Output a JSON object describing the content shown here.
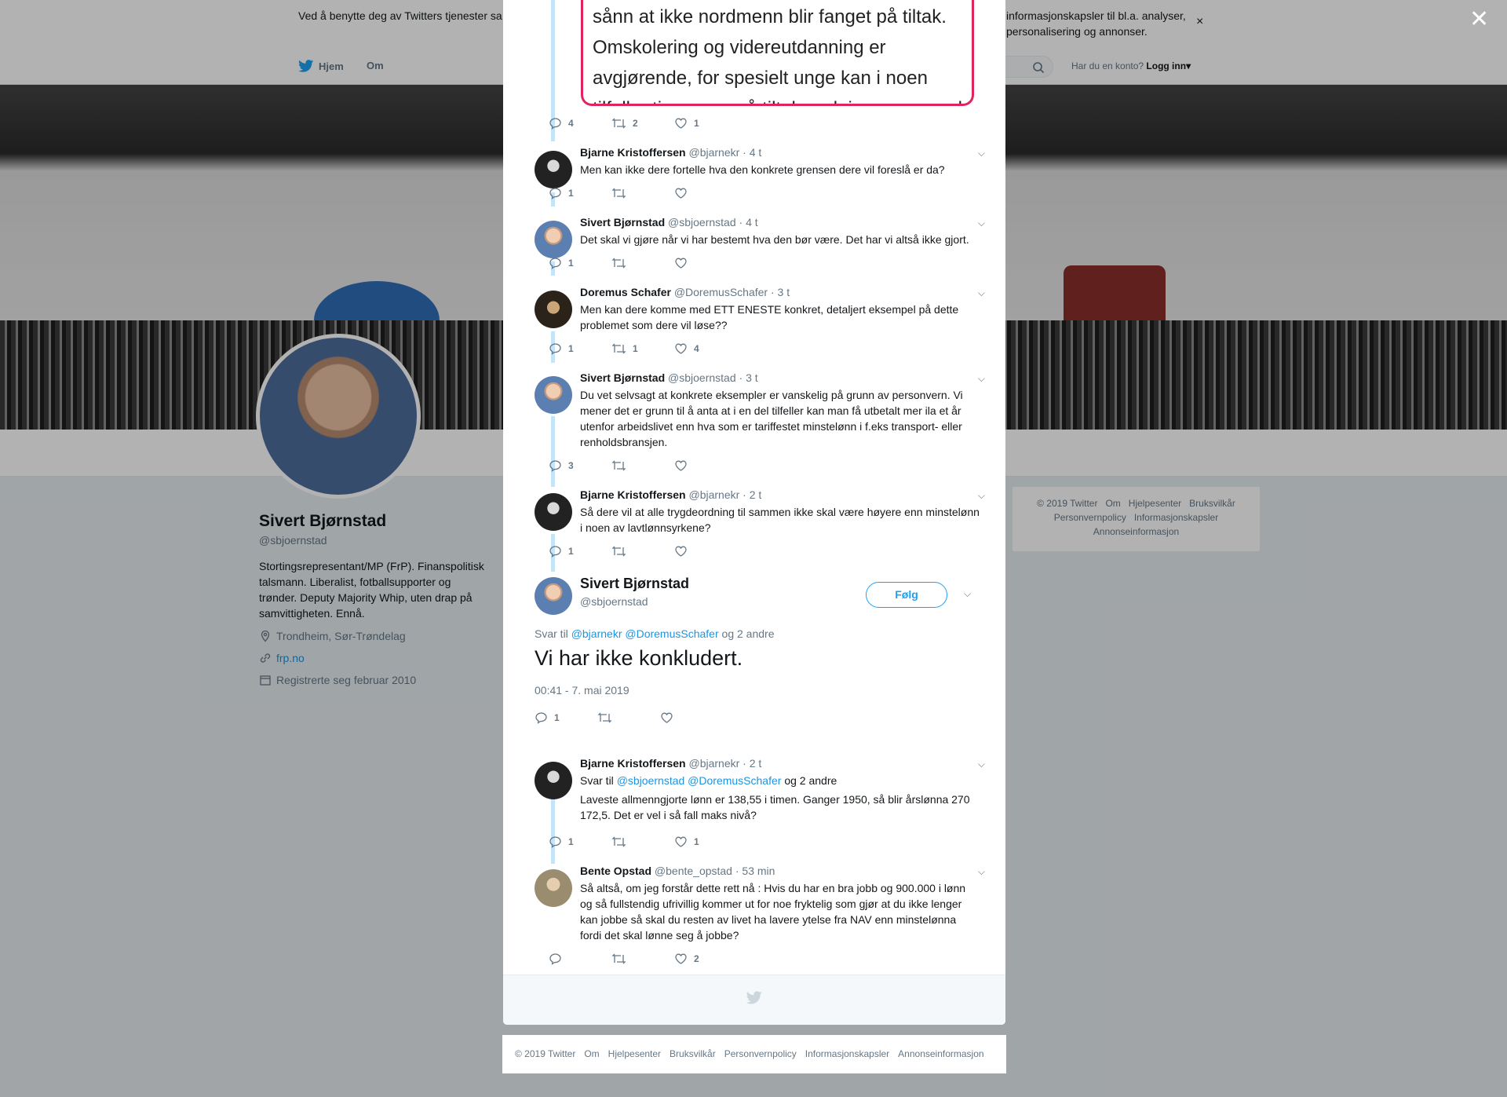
{
  "cookie": {
    "text_left": "Ved å benytte deg av Twitters tjenester sa",
    "text_right": "informasjonskapsler til bl.a. analyser, personalisering og annonser.",
    "close": "×"
  },
  "nav": {
    "home": "Hjem",
    "about": "Om",
    "login_prompt": "Har du en konto?",
    "login": "Logg inn"
  },
  "profile": {
    "name": "Sivert Bjørnstad",
    "handle": "@sbjoernstad",
    "bio": "Stortingsrepresentant/MP (FrP). Finanspolitisk talsmann. Liberalist, fotballsupporter og trønder. Deputy Majority Whip, uten drap på samvittigheten. Ennå.",
    "location": "Trondheim, Sør-Trøndelag",
    "website": "frp.no",
    "joined": "Registrerte seg februar 2010"
  },
  "side_footer": {
    "links": [
      "© 2019 Twitter",
      "Om",
      "Hjelpesenter",
      "Bruksvilkår",
      "Personvernpolicy",
      "Informasjonskapsler",
      "Annonseinformasjon"
    ]
  },
  "modal": {
    "close": "✕",
    "photo_lines": [
      "sånn at ikke nordmenn blir fanget på tiltak.",
      "Omskolering og videreutdanning er",
      "avgjørende, for spesielt unge kan i noen",
      "tilfeller tjene mer på tiltaksordninger enn ved å"
    ],
    "top_actions": {
      "replies": "4",
      "retweets": "2",
      "likes": "1"
    },
    "tweets": [
      {
        "name": "Bjarne Kristoffersen",
        "handle": "@bjarnekr",
        "time": "· 4 t",
        "text": "Men kan ikke dere fortelle hva den konkrete grensen dere vil foreslå er da?",
        "replies": "1",
        "retweets": "",
        "likes": ""
      },
      {
        "name": "Sivert Bjørnstad",
        "handle": "@sbjoernstad",
        "time": "· 4 t",
        "text": "Det skal vi gjøre når vi har bestemt hva den bør være. Det har vi altså ikke gjort.",
        "replies": "1",
        "retweets": "",
        "likes": ""
      },
      {
        "name": "Doremus Schafer",
        "handle": "@DoremusSchafer",
        "time": "· 3 t",
        "text": "Men kan dere komme med ETT ENESTE konkret, detaljert eksempel på dette problemet som dere vil løse??",
        "replies": "1",
        "retweets": "1",
        "likes": "4"
      },
      {
        "name": "Sivert Bjørnstad",
        "handle": "@sbjoernstad",
        "time": "· 3 t",
        "text": "Du vet selvsagt at konkrete eksempler er vanskelig på grunn av personvern. Vi mener det er grunn til å anta at i en del tilfeller kan man få utbetalt mer ila et år utenfor arbeidslivet enn hva som er tariffestet minstelønn i f.eks transport- eller renholdsbransjen.",
        "replies": "3",
        "retweets": "",
        "likes": ""
      },
      {
        "name": "Bjarne Kristoffersen",
        "handle": "@bjarnekr",
        "time": "· 2 t",
        "text": "Så dere vil at alle trygdeordning til sammen ikke skal være høyere enn minstelønn i noen av lavtlønnsyrkene?",
        "replies": "1",
        "retweets": "",
        "likes": ""
      }
    ],
    "main_tweet": {
      "name": "Sivert Bjørnstad",
      "handle": "@sbjoernstad",
      "follow": "Følg",
      "reply_prefix": "Svar til",
      "reply_mention1": "@bjarnekr",
      "reply_mention2": "@DoremusSchafer",
      "reply_suffix": "og 2 andre",
      "text": "Vi har ikke konkludert.",
      "timestamp": "00:41 - 7. mai 2019",
      "replies": "1"
    },
    "replies": [
      {
        "name": "Bjarne Kristoffersen",
        "handle": "@bjarnekr",
        "time": "· 2 t",
        "reply_prefix": "Svar til",
        "reply_mention1": "@sbjoernstad",
        "reply_mention2": "@DoremusSchafer",
        "reply_suffix": "og 2 andre",
        "text": "Laveste allmenngjorte lønn er 138,55 i timen. Ganger 1950, så blir årslønna 270 172,5. Det er vel i så fall maks nivå?",
        "replies": "1",
        "retweets": "",
        "likes": "1"
      },
      {
        "name": "Bente Opstad",
        "handle": "@bente_opstad",
        "time": "· 53 min",
        "text": "Så altså, om jeg forstår dette rett nå : Hvis du har en bra jobb og 900.000 i lønn og så fullstendig ufrivillig kommer ut for noe fryktelig som gjør at du ikke lenger kan jobbe så skal du resten av livet ha lavere ytelse fra NAV enn minstelønna fordi det skal lønne seg å jobbe?",
        "replies": "",
        "retweets": "",
        "likes": "2"
      }
    ]
  },
  "bottom_footer": {
    "links": [
      "© 2019 Twitter",
      "Om",
      "Hjelpesenter",
      "Bruksvilkår",
      "Personvernpolicy",
      "Informasjonskapsler",
      "Annonseinformasjon"
    ]
  }
}
